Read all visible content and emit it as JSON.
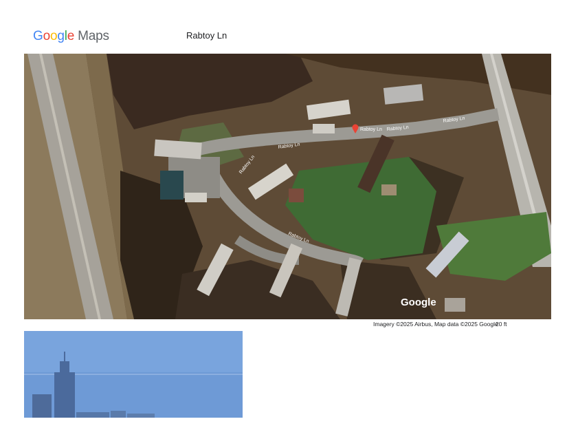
{
  "header": {
    "logo_letters": [
      "G",
      "o",
      "o",
      "g",
      "l",
      "e"
    ],
    "logo_maps": "Maps",
    "place_title": "Rabtoy Ln"
  },
  "map": {
    "type": "satellite",
    "watermark": "Google",
    "pin_label": "Rabtoy Ln",
    "road_labels": [
      "Rabtoy Ln",
      "Rabtoy Ln",
      "Rabtoy Ln",
      "Rabtoy Ln",
      "Rabtoy Ln"
    ],
    "pin_color": "#EA4335"
  },
  "footer": {
    "attribution": "Imagery ©2025 Airbus, Map data ©2025 Google",
    "scale_label": "20 ft"
  },
  "street_view": {
    "sky_color": "#6e9ad6"
  }
}
